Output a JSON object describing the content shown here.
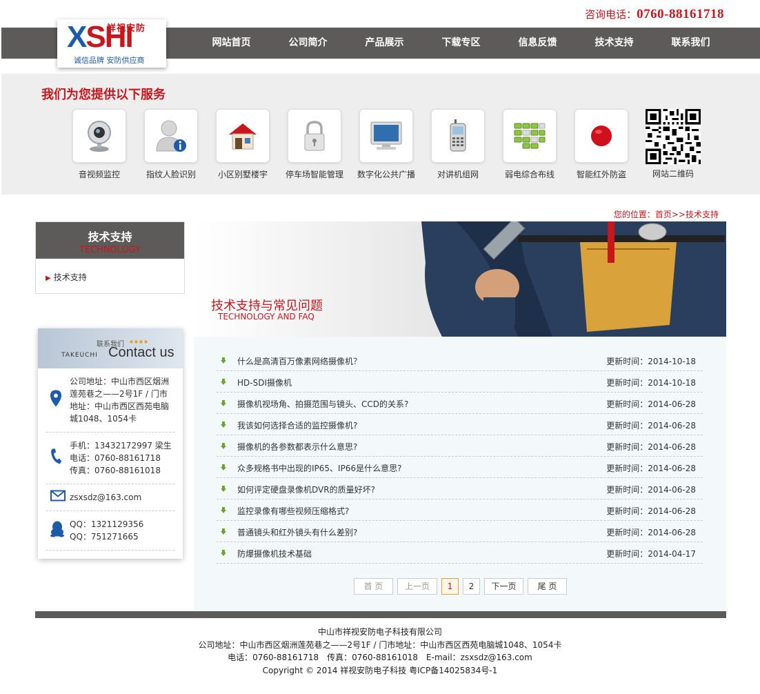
{
  "header": {
    "hotline_label": "咨询电话：",
    "hotline_number": "0760-88161718",
    "logo": {
      "mark_x": "X",
      "mark_s": "SHI",
      "brand": "祥视安防",
      "slogan": "诚信品牌 安防供应商"
    }
  },
  "nav": [
    "网站首页",
    "公司简介",
    "产品展示",
    "下载专区",
    "信息反馈",
    "技术支持",
    "联系我们"
  ],
  "services": {
    "title": "我们为您提供以下服务",
    "items": [
      {
        "label": "音视频监控",
        "icon": "webcam-icon"
      },
      {
        "label": "指纹人脸识别",
        "icon": "user-info-icon"
      },
      {
        "label": "小区别墅楼宇",
        "icon": "house-icon"
      },
      {
        "label": "停车场智能管理",
        "icon": "padlock-icon"
      },
      {
        "label": "数字化公共广播",
        "icon": "monitor-icon"
      },
      {
        "label": "对讲机组网",
        "icon": "mobile-phone-icon"
      },
      {
        "label": "弱电综合布线",
        "icon": "network-blocks-icon"
      },
      {
        "label": "智能红外防盗",
        "icon": "red-dot-icon"
      }
    ],
    "qr_label": "网站二维码"
  },
  "breadcrumb": "您的位置：首页>>技术支持",
  "sidebar": {
    "title": "技术支持",
    "subtitle": "TECHNOLOGY",
    "items": [
      "技术支持"
    ]
  },
  "contact": {
    "banner_cn": "联系我们",
    "banner_brand": "TAKEUCHI",
    "banner_en": "Contact us",
    "address": "公司地址：中山市西区烟洲莲苑巷之——2号1F / 门市地址：中山市西区西苑电脑城1048、1054卡",
    "phones": [
      "手机：13432172997 梁生",
      "电话：0760-88161718",
      "传真：0760-88161018"
    ],
    "email": "zsxsdz@163.com",
    "qq": [
      "QQ：1321129356",
      "QQ：751271665"
    ]
  },
  "hero": {
    "title": "技术支持与常见问题",
    "subtitle": "TECHNOLOGY AND FAQ"
  },
  "articles": [
    {
      "title": "什么是高清百万像素网络摄像机？",
      "date": "更新时间：2014-10-18"
    },
    {
      "title": "HD-SDI摄像机",
      "date": "更新时间：2014-10-18"
    },
    {
      "title": "摄像机视场角、拍摄范围与镜头、CCD的关系?",
      "date": "更新时间：2014-06-28"
    },
    {
      "title": "我该如何选择合适的监控摄像机?",
      "date": "更新时间：2014-06-28"
    },
    {
      "title": "摄像机的各参数都表示什么意思?",
      "date": "更新时间：2014-06-28"
    },
    {
      "title": "众多规格书中出现的IP65、IP66是什么意思?",
      "date": "更新时间：2014-06-28"
    },
    {
      "title": "如何评定硬盘录像机DVR的质量好坏?",
      "date": "更新时间：2014-06-28"
    },
    {
      "title": "监控录像有哪些视频压缩格式?",
      "date": "更新时间：2014-06-28"
    },
    {
      "title": "普通镜头和红外镜头有什么差别?",
      "date": "更新时间：2014-06-28"
    },
    {
      "title": "防爆摄像机技术基础",
      "date": "更新时间：2014-04-17"
    }
  ],
  "pager": {
    "first": "首 页",
    "prev": "上一页",
    "pages": [
      "1",
      "2"
    ],
    "current": "1",
    "next": "下一页",
    "last": "尾 页"
  },
  "footer": {
    "company": "中山市祥视安防电子科技有限公司",
    "address": "公司地址：中山市西区烟洲莲苑巷之——2号1F / 门市地址：中山市西区西苑电脑城1048、1054卡",
    "contact": "电话：0760-88161718　传真：0760-88161018　E-mail：zsxsdz@163.com",
    "copyright": "Copyright © 2014 祥视安防电子科技 粤ICP备14025834号-1"
  },
  "colors": {
    "accent": "#c8161d",
    "nav_bg": "#5d5b59",
    "brand_blue": "#1d5aa8",
    "list_bg": "#f3f9fa",
    "arrow_green": "#6ba32b"
  }
}
